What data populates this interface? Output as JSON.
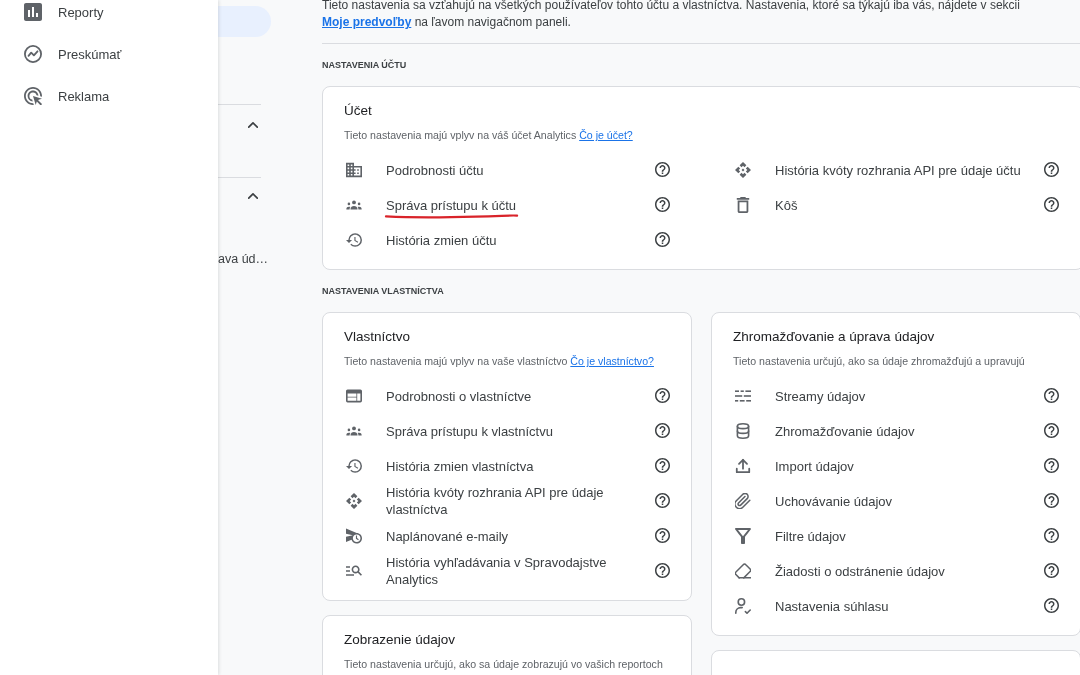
{
  "sidebar": {
    "items": [
      {
        "label": "Reporty",
        "selected": false
      },
      {
        "label": "Preskúmať",
        "selected": false
      },
      {
        "label": "Reklama",
        "selected": false
      }
    ]
  },
  "secondary_nav": {
    "top_item": {
      "selected": true
    },
    "sections": [
      {
        "expanded": true
      },
      {
        "expanded": true,
        "items": [
          {
            "label": "ava úd…",
            "selected": false
          }
        ]
      }
    ]
  },
  "intro": {
    "text": "Tieto nastavenia sa vzťahujú na všetkých používateľov tohto účtu a vlastníctva. Nastavenia, ktoré sa týkajú iba vás, nájdete v sekcii",
    "link": "Moje predvoľby",
    "text_after": "na ľavom navigačnom paneli."
  },
  "account_section": {
    "heading": "NASTAVENIA ÚČTU",
    "card": {
      "title": "Účet",
      "description": "Tieto nastavenia majú vplyv na váš účet Analytics",
      "link": "Čo je účet?",
      "columns": [
        {
          "items": [
            {
              "label": "Podrobnosti účtu",
              "marked": false
            },
            {
              "label": "Správa prístupu k účtu",
              "marked": true
            },
            {
              "label": "História zmien účtu",
              "marked": false
            }
          ]
        },
        {
          "items": [
            {
              "label": "História kvóty rozhrania API pre údaje účtu",
              "marked": false
            },
            {
              "label": "Kôš",
              "marked": false
            }
          ]
        }
      ]
    }
  },
  "property_section": {
    "heading": "NASTAVENIA VLASTNÍCTVA",
    "columns": [
      {
        "cards": [
          {
            "title": "Vlastníctvo",
            "description": "Tieto nastavenia majú vplyv na vaše vlastníctvo",
            "link": "Čo je vlastníctvo?",
            "items": [
              {
                "label": "Podrobnosti o vlastníctve"
              },
              {
                "label": "Správa prístupu k vlastníctvu"
              },
              {
                "label": "História zmien vlastníctva"
              },
              {
                "label": "História kvóty rozhrania API pre údaje vlastníctva"
              },
              {
                "label": "Naplánované e-maily"
              },
              {
                "label": "História vyhľadávania v Spravodajstve Analytics"
              }
            ]
          },
          {
            "title": "Zobrazenie údajov",
            "description": "Tieto nastavenia určujú, ako sa údaje zobrazujú vo vašich reportoch"
          }
        ]
      },
      {
        "cards": [
          {
            "title": "Zhromažďovanie a úprava údajov",
            "description": "Tieto nastavenia určujú, ako sa údaje zhromažďujú a upravujú",
            "items": [
              {
                "label": "Streamy údajov"
              },
              {
                "label": "Zhromažďovanie údajov"
              },
              {
                "label": "Import údajov"
              },
              {
                "label": "Uchovávanie údajov"
              },
              {
                "label": "Filtre údajov"
              },
              {
                "label": "Žiadosti o odstránenie údajov"
              },
              {
                "label": "Nastavenia súhlasu"
              }
            ]
          }
        ],
        "next_card_visible": true
      }
    ]
  }
}
